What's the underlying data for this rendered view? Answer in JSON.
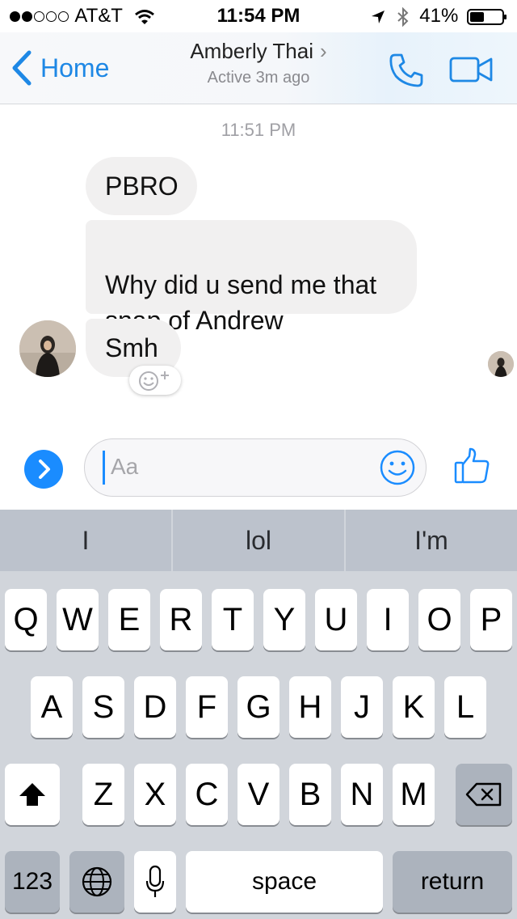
{
  "status_bar": {
    "carrier": "AT&T",
    "time": "11:54 PM",
    "battery": "41%",
    "signal_bars_filled": 2,
    "signal_bars_total": 5,
    "icons": [
      "wifi-icon",
      "location-arrow-icon",
      "bluetooth-icon",
      "battery-icon"
    ]
  },
  "nav": {
    "back_label": "Home",
    "contact_name": "Amberly Thai",
    "contact_status": "Active 3m ago",
    "icons": [
      "phone-icon",
      "video-call-icon"
    ]
  },
  "conversation": {
    "timestamp": "11:51 PM",
    "messages": [
      {
        "text": "PBRO"
      },
      {
        "text": "Why did u send me that\nsnap of Andrew"
      },
      {
        "text": "Smh"
      }
    ]
  },
  "composer": {
    "placeholder": "Aa",
    "icons": [
      "expand-icon",
      "emoji-icon",
      "thumbs-up-icon"
    ]
  },
  "keyboard": {
    "predictions": [
      "I",
      "lol",
      "I'm"
    ],
    "rows": [
      [
        "Q",
        "W",
        "E",
        "R",
        "T",
        "Y",
        "U",
        "I",
        "O",
        "P"
      ],
      [
        "A",
        "S",
        "D",
        "F",
        "G",
        "H",
        "J",
        "K",
        "L"
      ],
      [
        "Z",
        "X",
        "C",
        "V",
        "B",
        "N",
        "M"
      ]
    ],
    "numbers_label": "123",
    "space_label": "space",
    "return_label": "return"
  },
  "colors": {
    "accent": "#1a8cff",
    "bubble": "#f1f0f0",
    "keyboard_bg": "#d1d5db",
    "prediction_bar": "#bcc2cc"
  }
}
